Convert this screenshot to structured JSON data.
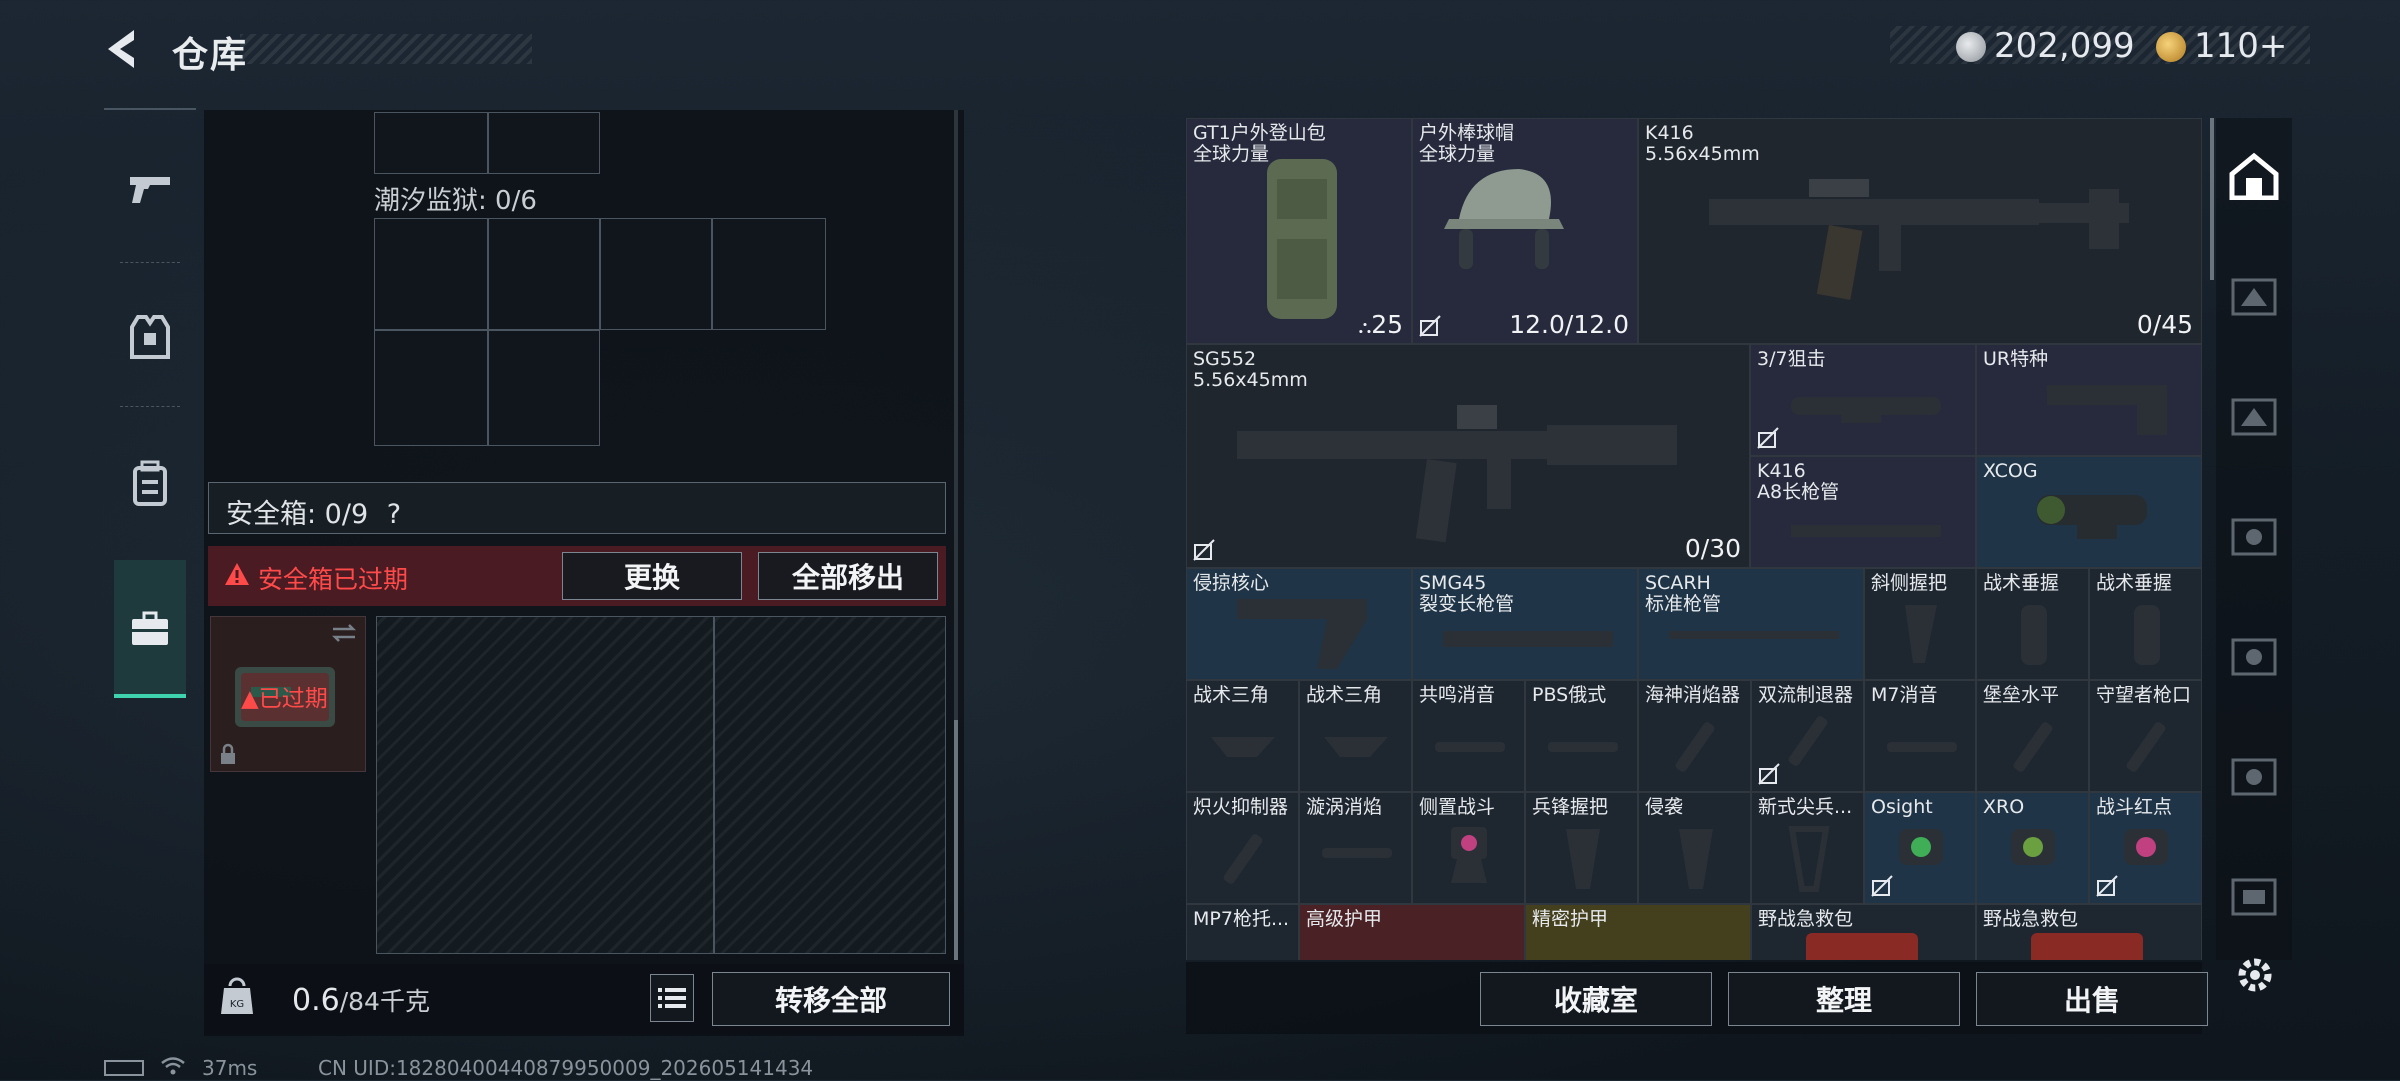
{
  "header": {
    "title": "仓库",
    "currency": [
      {
        "icon": "silver-coin-icon",
        "value": "202,099"
      },
      {
        "icon": "gold-coin-icon",
        "value": "110+"
      }
    ]
  },
  "nav": [
    {
      "name": "weapons",
      "icon": "pistol-icon"
    },
    {
      "name": "armor",
      "icon": "vest-icon"
    },
    {
      "name": "backpack",
      "icon": "backpack-icon"
    },
    {
      "name": "case",
      "icon": "briefcase-icon",
      "active": true
    }
  ],
  "left": {
    "container_label": "潮汐监狱: 0/6",
    "safebox_label": "安全箱: 0/9",
    "safebox_help": "?",
    "expired_warning": "安全箱已过期",
    "replace_button": "更换",
    "move_all_button": "全部移出",
    "thumb_badge": "已过期",
    "weight_value": "0.6",
    "weight_total": "/84千克",
    "transfer_all_button": "转移全部"
  },
  "items": [
    {
      "l1": "GT1户外登山包",
      "l2": "全球力量",
      "br": "25"
    },
    {
      "l1": "户外棒球帽",
      "l2": "全球力量",
      "br": "12.0/12.0"
    },
    {
      "l1": "K416",
      "l2": "5.56x45mm",
      "br": "0/45"
    },
    {
      "l1": "SG552",
      "l2": "5.56x45mm",
      "br": "0/30"
    },
    {
      "l1": "3/7狙击",
      "l2": ""
    },
    {
      "l1": "UR特种",
      "l2": ""
    },
    {
      "l1": "K416",
      "l2": "A8长枪管"
    },
    {
      "l1": "XCOG",
      "l2": ""
    },
    {
      "l1": "侵掠核心",
      "l2": ""
    },
    {
      "l1": "SMG45",
      "l2": "裂变长枪管"
    },
    {
      "l1": "SCARH",
      "l2": "标准枪管"
    },
    {
      "l1": "斜侧握把"
    },
    {
      "l1": "战术垂握"
    },
    {
      "l1": "战术垂握"
    },
    {
      "l1": "战术三角"
    },
    {
      "l1": "战术三角"
    },
    {
      "l1": "共鸣消音"
    },
    {
      "l1": "PBS俄式"
    },
    {
      "l1": "海神消焰器"
    },
    {
      "l1": "双流制退器"
    },
    {
      "l1": "M7消音"
    },
    {
      "l1": "堡垒水平"
    },
    {
      "l1": "守望者枪口"
    },
    {
      "l1": "炽火抑制器"
    },
    {
      "l1": "漩涡消焰"
    },
    {
      "l1": "侧置战斗"
    },
    {
      "l1": "兵锋握把"
    },
    {
      "l1": "侵袭"
    },
    {
      "l1": "新式尖兵..."
    },
    {
      "l1": "Osight"
    },
    {
      "l1": "XRO"
    },
    {
      "l1": "战斗红点"
    },
    {
      "l1": "MP7枪托..."
    },
    {
      "l1": "高级护甲"
    },
    {
      "l1": "精密护甲"
    },
    {
      "l1": "野战急救包"
    },
    {
      "l1": "野战急救包"
    }
  ],
  "bottom_buttons": {
    "collection": "收藏室",
    "sort": "整理",
    "sell": "出售"
  },
  "status": {
    "ping": "37ms",
    "uid": "CN UID:18280400440879950009_202605141434"
  },
  "colors": {
    "accent": "#3fd3b0",
    "warning": "#ff4a4a"
  }
}
